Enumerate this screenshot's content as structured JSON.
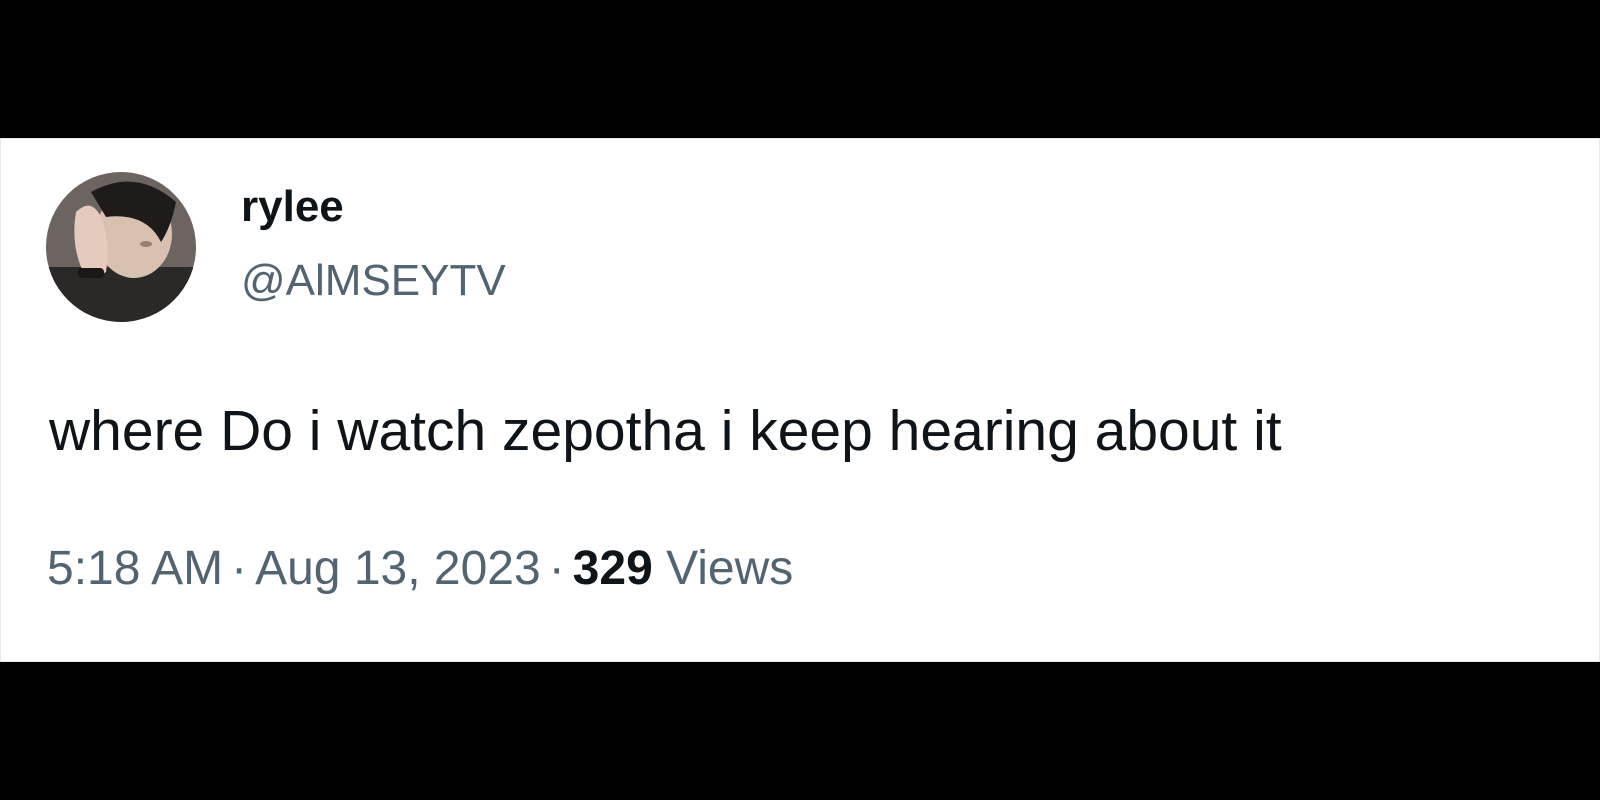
{
  "tweet": {
    "user": {
      "name": "rylee",
      "handle": "@AlMSEYTV",
      "avatar": "profile-photo"
    },
    "text": "where Do i watch zepotha i keep hearing about it",
    "meta": {
      "time": "5:18 AM",
      "separator": "·",
      "date": "Aug 13, 2023",
      "views_count": "329",
      "views_label": "Views"
    }
  },
  "colors": {
    "background": "#000000",
    "card": "#ffffff",
    "primary_text": "#0f1419",
    "secondary_text": "#536471"
  }
}
